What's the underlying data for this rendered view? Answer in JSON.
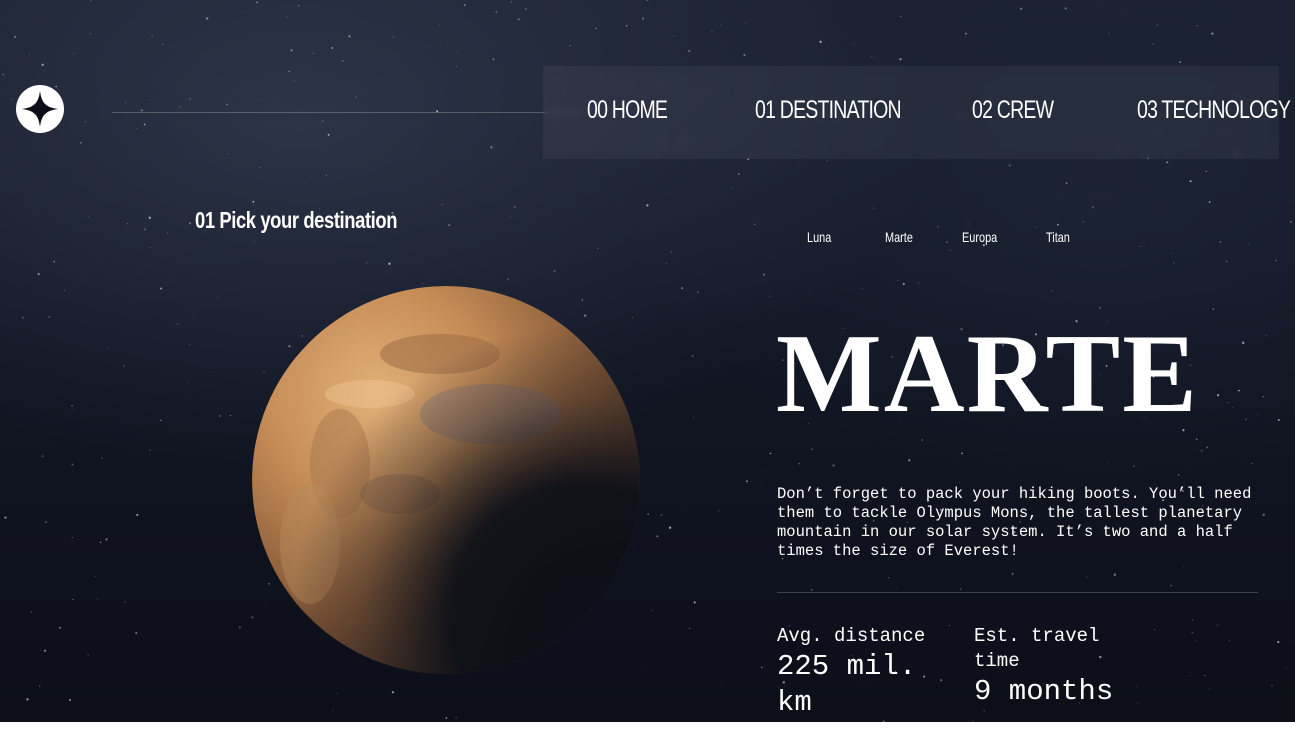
{
  "header": {
    "logo_icon": "four-point-star-icon",
    "nav": [
      {
        "label": "00 HOME"
      },
      {
        "label": "01 DESTINATION"
      },
      {
        "label": "02 CREW"
      },
      {
        "label": "03 TECHNOLOGY"
      }
    ]
  },
  "main": {
    "pick_title": "01 Pick your destination",
    "tabs": [
      {
        "label": "Luna"
      },
      {
        "label": "Marte"
      },
      {
        "label": "Europa"
      },
      {
        "label": "Titan"
      }
    ],
    "planet": {
      "name": "MARTE",
      "description": "Don’t forget to pack your hiking boots. You’ll need them to tackle Olympus Mons, the tallest planetary mountain in our solar system. It’s two and a half times the size of Everest!",
      "stats": [
        {
          "label": "Avg. distance",
          "value": "225 mil. km"
        },
        {
          "label": "Est. travel time",
          "value": "9 months"
        }
      ]
    }
  },
  "colors": {
    "background_dark": "#0c0f18",
    "text": "#ffffff",
    "mars_light": "#d9a46a",
    "mars_dark": "#7a4a2a"
  }
}
